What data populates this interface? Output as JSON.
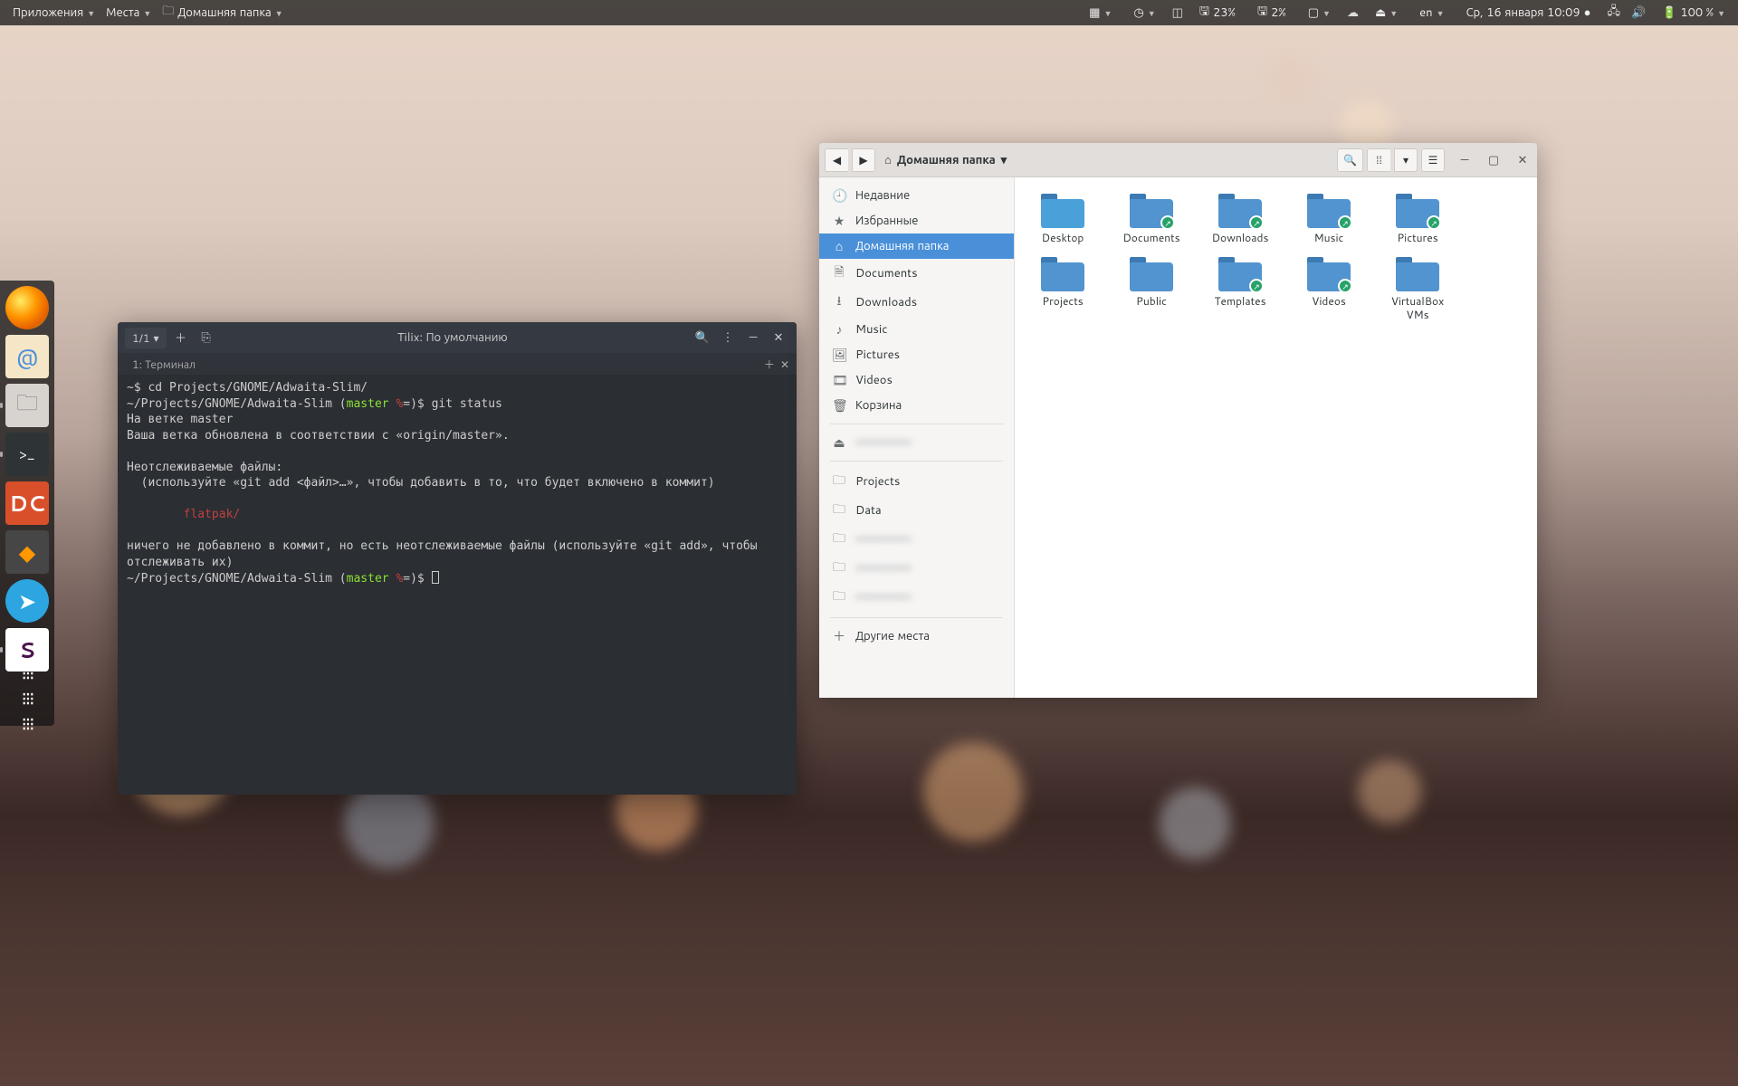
{
  "topbar": {
    "applications": "Приложения",
    "places": "Места",
    "current_window": "Домашняя папка",
    "batt1": "23%",
    "batt2": "2%",
    "lang": "en",
    "clock": "Ср, 16 января  10:09",
    "batt_main": "100 %"
  },
  "dock": {
    "items": [
      "firefox",
      "mail",
      "files",
      "terminal",
      "doublecmd",
      "sublime",
      "telegram",
      "slack",
      "apps-grid"
    ]
  },
  "terminal": {
    "session": "1/1",
    "title": "Tilix: По умолчанию",
    "tab": "1: Терминал",
    "lines": {
      "l1_prompt": "~$ ",
      "l1_cmd": "cd Projects/GNOME/Adwaita-Slim/",
      "l2_path": "~/Projects/GNOME/Adwaita-Slim (",
      "l2_branch": "master ",
      "l2_mark": "%",
      "l2_end": "=)$ ",
      "l2_cmd": "git status",
      "l3": "На ветке master",
      "l4": "Ваша ветка обновлена в соответствии с «origin/master».",
      "l5": "Неотслеживаемые файлы:",
      "l6": "  (используйте «git add <файл>…», чтобы добавить в то, что будет включено в коммит)",
      "l7": "        flatpak/",
      "l8": "ничего не добавлено в коммит, но есть неотслеживаемые файлы (используйте «git add», чтобы отслеживать их)",
      "l9_path": "~/Projects/GNOME/Adwaita-Slim (",
      "l9_branch": "master ",
      "l9_mark": "%",
      "l9_end": "=)$ "
    }
  },
  "nautilus": {
    "path_label": "Домашняя папка",
    "sidebar": {
      "recent": "Недавние",
      "starred": "Избранные",
      "home": "Домашняя папка",
      "documents": "Documents",
      "downloads": "Downloads",
      "music": "Music",
      "pictures": "Pictures",
      "videos": "Videos",
      "trash": "Корзина",
      "network_item": "———————",
      "projects": "Projects",
      "data": "Data",
      "b1": "———————",
      "b2": "———————",
      "b3": "———————",
      "other": "Другие места"
    },
    "files": [
      {
        "name": "Desktop",
        "link": false,
        "desktop": true
      },
      {
        "name": "Documents",
        "link": true
      },
      {
        "name": "Downloads",
        "link": true
      },
      {
        "name": "Music",
        "link": true
      },
      {
        "name": "Pictures",
        "link": true
      },
      {
        "name": "Projects",
        "link": false
      },
      {
        "name": "Public",
        "link": false
      },
      {
        "name": "Templates",
        "link": true
      },
      {
        "name": "Videos",
        "link": true
      },
      {
        "name": "VirtualBox VMs",
        "link": false
      }
    ]
  }
}
